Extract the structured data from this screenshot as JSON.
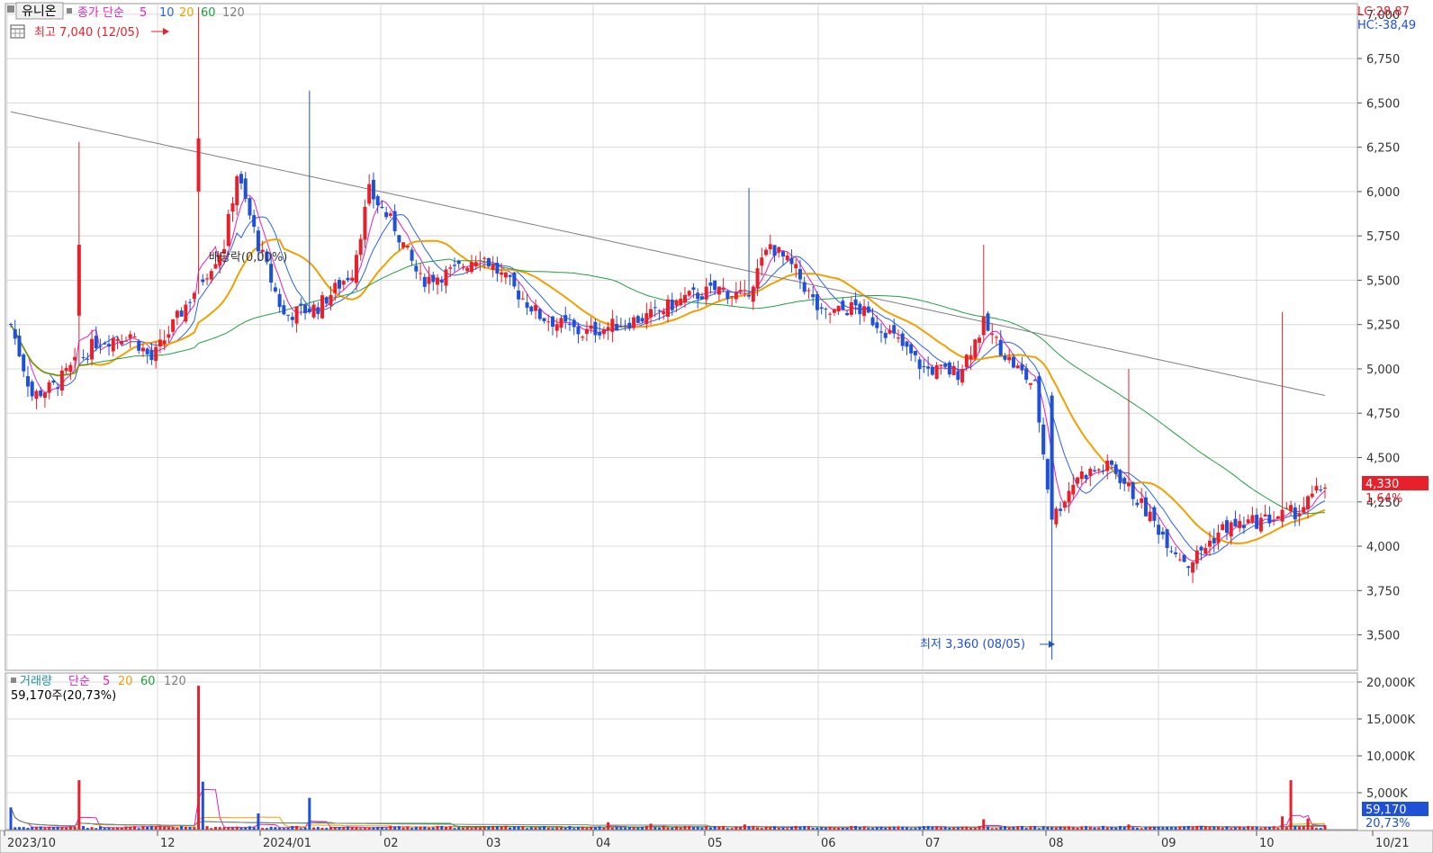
{
  "stock_name": "유니온",
  "legend": {
    "price_label": "종가 단순",
    "ma": [
      {
        "label": "5",
        "color": "#e020c0"
      },
      {
        "label": "10",
        "color": "#2a64e8"
      },
      {
        "label": "20",
        "color": "#f0a000"
      },
      {
        "label": "60",
        "color": "#20a040"
      },
      {
        "label": "120",
        "color": "#808080"
      }
    ],
    "volume_label": "거래량",
    "volume_ma_label": "단순",
    "volume_ma": [
      {
        "label": "5",
        "color": "#e020c0"
      },
      {
        "label": "20",
        "color": "#f0a000"
      },
      {
        "label": "60",
        "color": "#20a040"
      },
      {
        "label": "120",
        "color": "#808080"
      }
    ]
  },
  "annotations": {
    "high": "최고 7,040 (12/05)",
    "low": "최저 3,360 (08/05)",
    "dividend": "배당락(0,00%)",
    "volume_info": "59,170주(20,73%)",
    "lc": "LC:28,87",
    "hc": "HC:-38,49"
  },
  "current": {
    "price": "4,330",
    "change": "1,64%",
    "volume": "59,170",
    "volume_pct": "20,73%"
  },
  "colors": {
    "up": "#e8202a",
    "down": "#1e50d8",
    "grid": "#d8d8d8",
    "axis_text": "#333333"
  },
  "chart_data": {
    "type": "candlestick",
    "price_axis": {
      "ticks": [
        "7,000",
        "6,750",
        "6,500",
        "6,250",
        "6,000",
        "5,750",
        "5,500",
        "5,250",
        "5,000",
        "4,750",
        "4,500",
        "4,250",
        "4,000",
        "3,750",
        "3,500"
      ],
      "ylim": [
        3300,
        7060
      ]
    },
    "volume_axis": {
      "ticks": [
        "20,000K",
        "15,000K",
        "10,000K",
        "5,000K"
      ],
      "ylim": [
        0,
        20000
      ]
    },
    "x_ticks": [
      "2023/10",
      "12",
      "2024/01",
      "02",
      "03",
      "04",
      "05",
      "06",
      "07",
      "08",
      "09",
      "10",
      "10/21"
    ],
    "price_series": [
      {
        "date": "2023-10",
        "close": 5200
      },
      {
        "date": "2023-11",
        "close": 5150
      },
      {
        "date": "2023-12-05",
        "close": 6700
      },
      {
        "date": "2023-12",
        "close": 5300
      },
      {
        "date": "2024-01",
        "close": 6200
      },
      {
        "date": "2024-02",
        "close": 5600
      },
      {
        "date": "2024-03",
        "close": 5250
      },
      {
        "date": "2024-04",
        "close": 5200
      },
      {
        "date": "2024-05",
        "close": 5700
      },
      {
        "date": "2024-06",
        "close": 5300
      },
      {
        "date": "2024-07",
        "close": 5000
      },
      {
        "date": "2024-08-05",
        "close": 4150
      },
      {
        "date": "2024-09",
        "close": 3900
      },
      {
        "date": "2024-10",
        "close": 4330
      }
    ],
    "high": {
      "date": "2023-12-05",
      "value": 7040
    },
    "low": {
      "date": "2024-08-05",
      "value": 3360
    },
    "last_close": 4330,
    "last_volume": 59170
  }
}
